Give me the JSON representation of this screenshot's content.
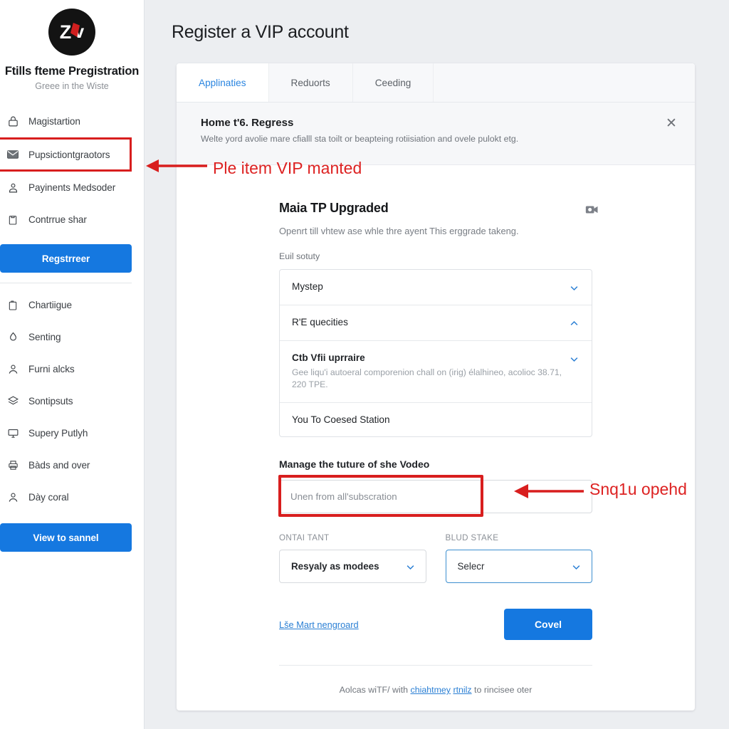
{
  "sidebar": {
    "logo": {
      "primary": "Z",
      "secondary": "v",
      "icon": "zv-logo"
    },
    "brand_title": "Ftills fteme Pregistration",
    "brand_subtitle": "Greee in the Wiste",
    "nav_top": [
      {
        "label": "Magistartion",
        "icon": "lock-icon",
        "highlighted": false
      },
      {
        "label": "Pupsictiontgraotors",
        "icon": "mail-icon",
        "highlighted": true
      },
      {
        "label": "Payinents Medsoder",
        "icon": "user-badge-icon",
        "highlighted": false
      },
      {
        "label": "Contrrue shar",
        "icon": "box-icon",
        "highlighted": false
      }
    ],
    "primary_button": "Regstrreer",
    "nav_bottom": [
      {
        "label": "Chartiigue",
        "icon": "clipboard-icon"
      },
      {
        "label": "Senting",
        "icon": "droplet-icon"
      },
      {
        "label": "Furni alcks",
        "icon": "person-icon"
      },
      {
        "label": "Sontipsuts",
        "icon": "layers-icon"
      },
      {
        "label": "Supery Putlyh",
        "icon": "monitor-icon"
      },
      {
        "label": "Bàds and over",
        "icon": "printer-icon"
      },
      {
        "label": "Dày coral",
        "icon": "person-icon"
      }
    ],
    "bottom_button": "View to sannel"
  },
  "main": {
    "page_title": "Register a VIP account",
    "tabs": [
      {
        "label": "Applinaties",
        "active": true
      },
      {
        "label": "Reduorts",
        "active": false
      },
      {
        "label": "Ceeding",
        "active": false
      }
    ],
    "notice": {
      "title": "Home t'6. Regress",
      "body": "Welte yord avolie mare cfialll sta toilt or beapteing rotiisiation and ovele pulokt etg.",
      "close_icon": "close-icon"
    },
    "section": {
      "title": "Maia TP Upgraded",
      "description": "Openrt till vhtew ase whle thre ayent This erggrade takeng.",
      "camera_icon": "camera-icon",
      "field_label": "Euil sotuty"
    },
    "accordion": [
      {
        "title": "Mystep",
        "sub": "",
        "chevron": "chevron-down-icon",
        "bold": false
      },
      {
        "title": "R'E quecities",
        "sub": "",
        "chevron": "chevron-up-icon",
        "bold": false
      },
      {
        "title": "Ctb Vfii uprraire",
        "sub": "Gee liqu'i autoeral comporenion chall on (irig) élalhineo, acolioc 38.71, 220 TPE.",
        "chevron": "chevron-down-icon",
        "bold": true
      },
      {
        "title": "You To Coesed Station",
        "sub": "",
        "chevron": "",
        "bold": false
      }
    ],
    "manage": {
      "label": "Manage the tuture of she Vodeo",
      "input_value": "Unen from all'subscration",
      "input_placeholder": "Unen from all'subscration"
    },
    "selects": [
      {
        "label": "ONTAI TANT",
        "value": "Resyaly as modees",
        "chevron": "chevron-down-icon",
        "focused": false
      },
      {
        "label": "BLUD STAKE",
        "value": "Selecr",
        "chevron": "chevron-down-icon",
        "focused": true
      }
    ],
    "footer": {
      "link": "Lše Mart nengroard",
      "button": "Covel",
      "note_prefix": "Aolcas wiTF/ with ",
      "note_link1": "chiahtmey",
      "note_mid": " ",
      "note_link2": "rtnilz",
      "note_suffix": " to rincisee oter"
    }
  },
  "annotations": [
    {
      "text": "Ple item VIP manted",
      "color": "#dd2222",
      "arrow": "left-arrow"
    },
    {
      "text": "Snq1u opehd",
      "color": "#dd2222",
      "arrow": "left-arrow"
    }
  ],
  "colors": {
    "accent_blue": "#1578e0",
    "link_blue": "#2a7fd4",
    "annotation_red": "#d81e1e",
    "page_bg": "#eceef1",
    "sidebar_bg": "#ffffff"
  }
}
